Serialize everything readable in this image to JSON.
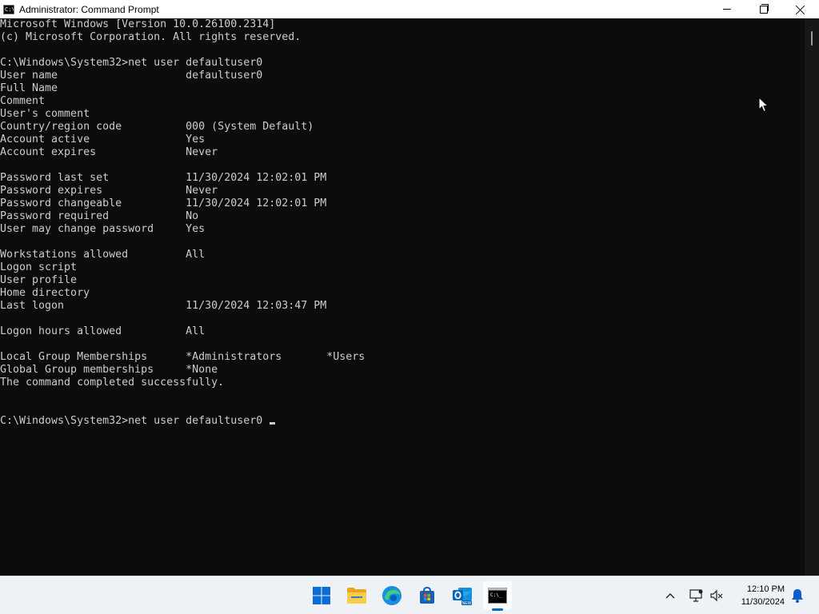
{
  "window": {
    "title": "Administrator: Command Prompt",
    "controls": {
      "minimize": "minimize",
      "maximize": "maximize",
      "close": "close"
    }
  },
  "console": {
    "lines": [
      "Microsoft Windows [Version 10.0.26100.2314]",
      "(c) Microsoft Corporation. All rights reserved.",
      "",
      "C:\\Windows\\System32>net user defaultuser0",
      "User name                    defaultuser0",
      "Full Name",
      "Comment",
      "User's comment",
      "Country/region code          000 (System Default)",
      "Account active               Yes",
      "Account expires              Never",
      "",
      "Password last set            11/30/2024 12:02:01 PM",
      "Password expires             Never",
      "Password changeable          11/30/2024 12:02:01 PM",
      "Password required            No",
      "User may change password     Yes",
      "",
      "Workstations allowed         All",
      "Logon script",
      "User profile",
      "Home directory",
      "Last logon                   11/30/2024 12:03:47 PM",
      "",
      "Logon hours allowed          All",
      "",
      "Local Group Memberships      *Administrators       *Users",
      "Global Group memberships     *None",
      "The command completed successfully.",
      "",
      ""
    ],
    "prompt_line": "C:\\Windows\\System32>net user defaultuser0 "
  },
  "taskbar": {
    "apps": [
      {
        "name": "start",
        "icon": "windows-logo-icon",
        "active": false
      },
      {
        "name": "file-explorer",
        "icon": "folder-icon",
        "active": false
      },
      {
        "name": "edge",
        "icon": "edge-icon",
        "active": false
      },
      {
        "name": "store",
        "icon": "store-icon",
        "active": false
      },
      {
        "name": "outlook-new",
        "icon": "outlook-icon",
        "badge": "NEW",
        "active": false
      },
      {
        "name": "command-prompt",
        "icon": "terminal-icon",
        "active": true
      }
    ],
    "tray": {
      "chevron": "chevron-up-icon",
      "network": "network-icon",
      "volume": "volume-muted-icon",
      "notifications": "bell-icon"
    },
    "clock": {
      "time": "12:10 PM",
      "date": "11/30/2024"
    }
  },
  "colors": {
    "console_bg": "#0c0c0c",
    "console_text": "#cccccc",
    "taskbar_bg": "#eef1f6",
    "accent": "#0067c0"
  }
}
